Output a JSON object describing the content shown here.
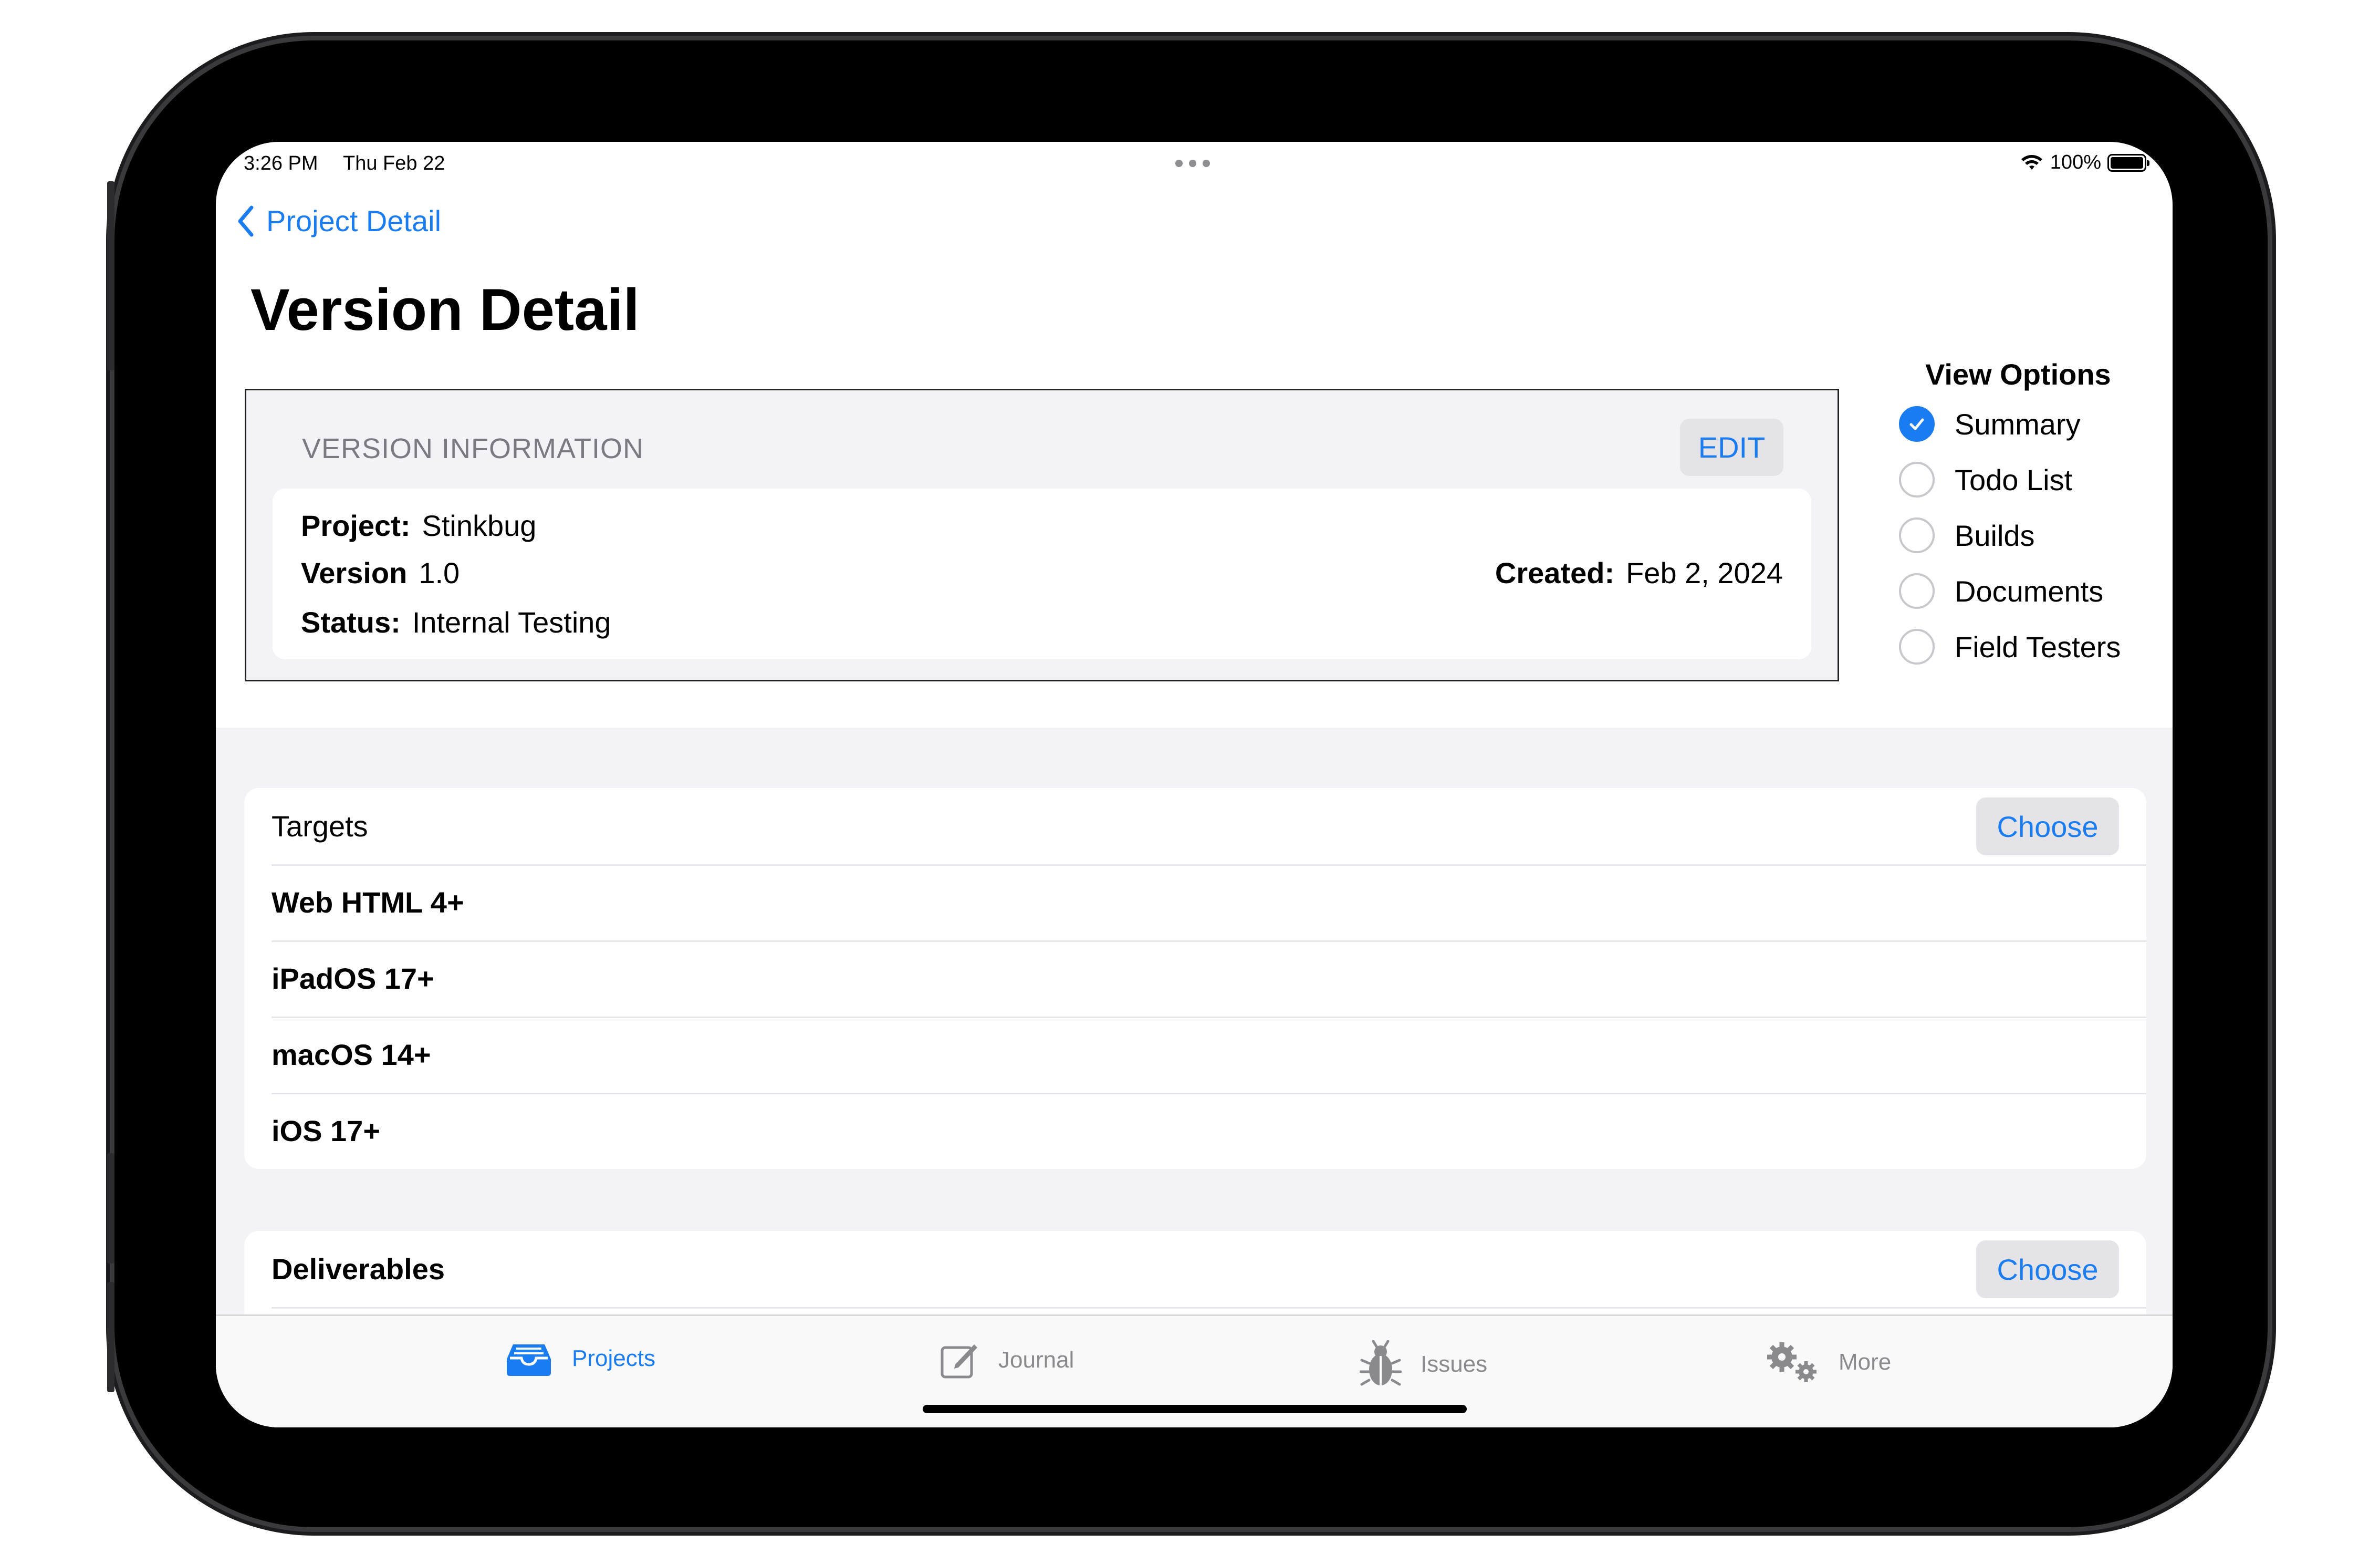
{
  "status_bar": {
    "time": "3:26 PM",
    "date": "Thu Feb 22",
    "battery": "100%"
  },
  "nav": {
    "back_label": "Project Detail",
    "title": "Version Detail"
  },
  "version_info": {
    "header": "VERSION INFORMATION",
    "edit_label": "EDIT",
    "project_label": "Project:",
    "project_value": "Stinkbug",
    "version_label": "Version",
    "version_value": "1.0",
    "status_label": "Status:",
    "status_value": "Internal Testing",
    "created_label": "Created:",
    "created_value": "Feb 2, 2024"
  },
  "view_options": {
    "title": "View Options",
    "items": [
      {
        "label": "Summary",
        "selected": true
      },
      {
        "label": "Todo List",
        "selected": false
      },
      {
        "label": "Builds",
        "selected": false
      },
      {
        "label": "Documents",
        "selected": false
      },
      {
        "label": "Field Testers",
        "selected": false
      }
    ]
  },
  "targets": {
    "header": "Targets",
    "choose_label": "Choose",
    "items": [
      "Web HTML 4+",
      "iPadOS 17+",
      "macOS 14+",
      "iOS 17+"
    ]
  },
  "deliverables": {
    "header": "Deliverables",
    "choose_label": "Choose"
  },
  "tabbar": {
    "tabs": [
      {
        "label": "Projects",
        "icon": "tray-icon",
        "active": true
      },
      {
        "label": "Journal",
        "icon": "compose-icon",
        "active": false
      },
      {
        "label": "Issues",
        "icon": "ladybug-icon",
        "active": false
      },
      {
        "label": "More",
        "icon": "gears-icon",
        "active": false
      }
    ]
  },
  "colors": {
    "accent": "#1a7cf1",
    "grouped_background": "#f2f2f7",
    "secondary_text": "#8a8a8e"
  }
}
